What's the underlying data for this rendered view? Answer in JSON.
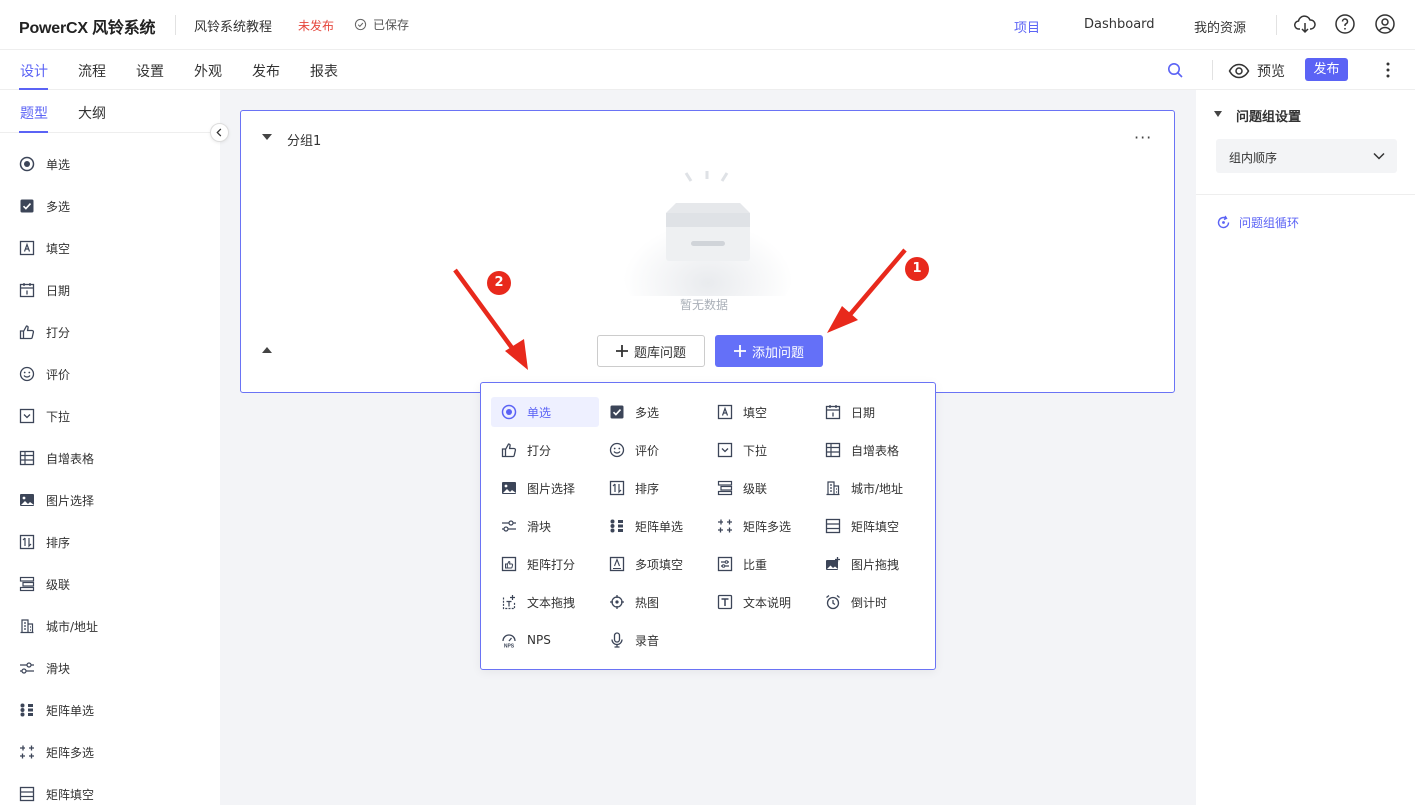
{
  "header": {
    "logo": "PowerCX 风铃系统",
    "project_name": "风铃系统教程",
    "publish_status": "未发布",
    "save_status": "已保存",
    "nav": [
      "项目",
      "Dashboard",
      "我的资源"
    ]
  },
  "tabs": [
    "设计",
    "流程",
    "设置",
    "外观",
    "发布",
    "报表"
  ],
  "toolbar": {
    "preview": "预览",
    "publish": "发布"
  },
  "left_panel": {
    "tabs": [
      "题型",
      "大纲"
    ],
    "items": [
      "单选",
      "多选",
      "填空",
      "日期",
      "打分",
      "评价",
      "下拉",
      "自增表格",
      "图片选择",
      "排序",
      "级联",
      "城市/地址",
      "滑块",
      "矩阵单选",
      "矩阵多选",
      "矩阵填空"
    ]
  },
  "group": {
    "title": "分组1",
    "empty_text": "暂无数据",
    "bank_button": "题库问题",
    "add_button": "添加问题"
  },
  "popup": {
    "items": [
      "单选",
      "多选",
      "填空",
      "日期",
      "打分",
      "评价",
      "下拉",
      "自增表格",
      "图片选择",
      "排序",
      "级联",
      "城市/地址",
      "滑块",
      "矩阵单选",
      "矩阵多选",
      "矩阵填空",
      "矩阵打分",
      "多项填空",
      "比重",
      "图片拖拽",
      "文本拖拽",
      "热图",
      "文本说明",
      "倒计时",
      "NPS",
      "录音"
    ]
  },
  "right_panel": {
    "title": "问题组设置",
    "select_value": "组内顺序",
    "loop": "问题组循环"
  },
  "annotations": [
    "1",
    "2"
  ],
  "colors": {
    "accent": "#5b63f5",
    "unpublished": "#e5463c",
    "annotation": "#e8291c"
  }
}
